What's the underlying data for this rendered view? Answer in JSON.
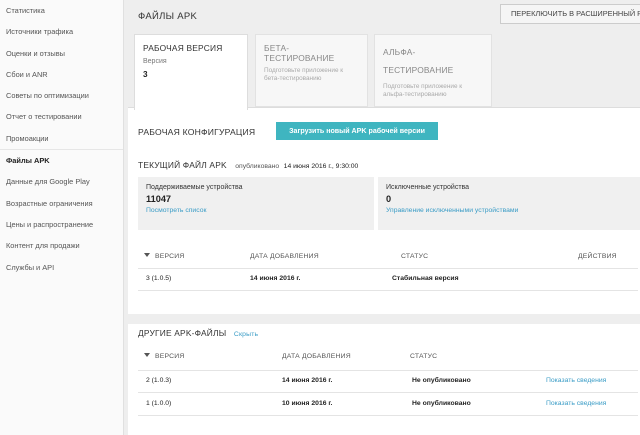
{
  "sidebar": {
    "items": [
      {
        "label": "Статистика"
      },
      {
        "label": "Источники трафика"
      },
      {
        "label": "Оценки и отзывы"
      },
      {
        "label": "Сбои и ANR"
      },
      {
        "label": "Советы по оптимизации"
      },
      {
        "label": "Отчет о тестировании"
      },
      {
        "label": "Промоакции"
      },
      {
        "label": "Файлы APK"
      },
      {
        "label": "Данные для Google Play"
      },
      {
        "label": "Возрастные ограничения"
      },
      {
        "label": "Цены и распространение"
      },
      {
        "label": "Контент для продажи"
      },
      {
        "label": "Службы и API"
      }
    ]
  },
  "header": {
    "title": "ФАЙЛЫ APK",
    "switch_button": "ПЕРЕКЛЮЧИТЬ В РАСШИРЕННЫЙ Р"
  },
  "tabs": [
    {
      "title": "РАБОЧАЯ ВЕРСИЯ",
      "sub": "Версия",
      "num": "3"
    },
    {
      "title": "БЕТА-ТЕСТИРОВАНИЕ",
      "desc": "Подготовьте приложение к бета-тестированию"
    },
    {
      "title": "АЛЬФА-ТЕСТИРОВАНИЕ",
      "desc": "Подготовьте приложение к альфа-тестированию"
    }
  ],
  "config": {
    "title": "РАБОЧАЯ КОНФИГУРАЦИЯ",
    "upload_button": "Загрузить новый APK рабочей версии"
  },
  "current": {
    "title": "ТЕКУЩИЙ ФАЙЛ APK",
    "published_label": "опубликовано",
    "published_date": "14 июня 2016 г., 9:30:00"
  },
  "devices": {
    "supported_label": "Поддерживаемые устройства",
    "supported_count": "11047",
    "supported_link": "Посмотреть список",
    "excluded_label": "Исключенные устройства",
    "excluded_count": "0",
    "excluded_link": "Управление исключенными устройствами"
  },
  "current_table": {
    "headers": {
      "version": "ВЕРСИЯ",
      "date": "ДАТА ДОБАВЛЕНИЯ",
      "status": "СТАТУС",
      "actions": "ДЕЙСТВИЯ"
    },
    "rows": [
      {
        "version": "3 (1.0.5)",
        "date": "14 июня 2016 г.",
        "status": "Стабильная версия"
      }
    ]
  },
  "other": {
    "title": "ДРУГИЕ APK-ФАЙЛЫ",
    "hide_link": "Скрыть",
    "headers": {
      "version": "ВЕРСИЯ",
      "date": "ДАТА ДОБАВЛЕНИЯ",
      "status": "СТАТУС"
    },
    "rows": [
      {
        "version": "2 (1.0.3)",
        "date": "14 июня 2016 г.",
        "status": "Не опубликовано",
        "action": "Показать сведения"
      },
      {
        "version": "1 (1.0.0)",
        "date": "10 июня 2016 г.",
        "status": "Не опубликовано",
        "action": "Показать сведения"
      }
    ]
  },
  "colors": {
    "accent": "#3fb5c0",
    "link": "#3a9cc6"
  }
}
